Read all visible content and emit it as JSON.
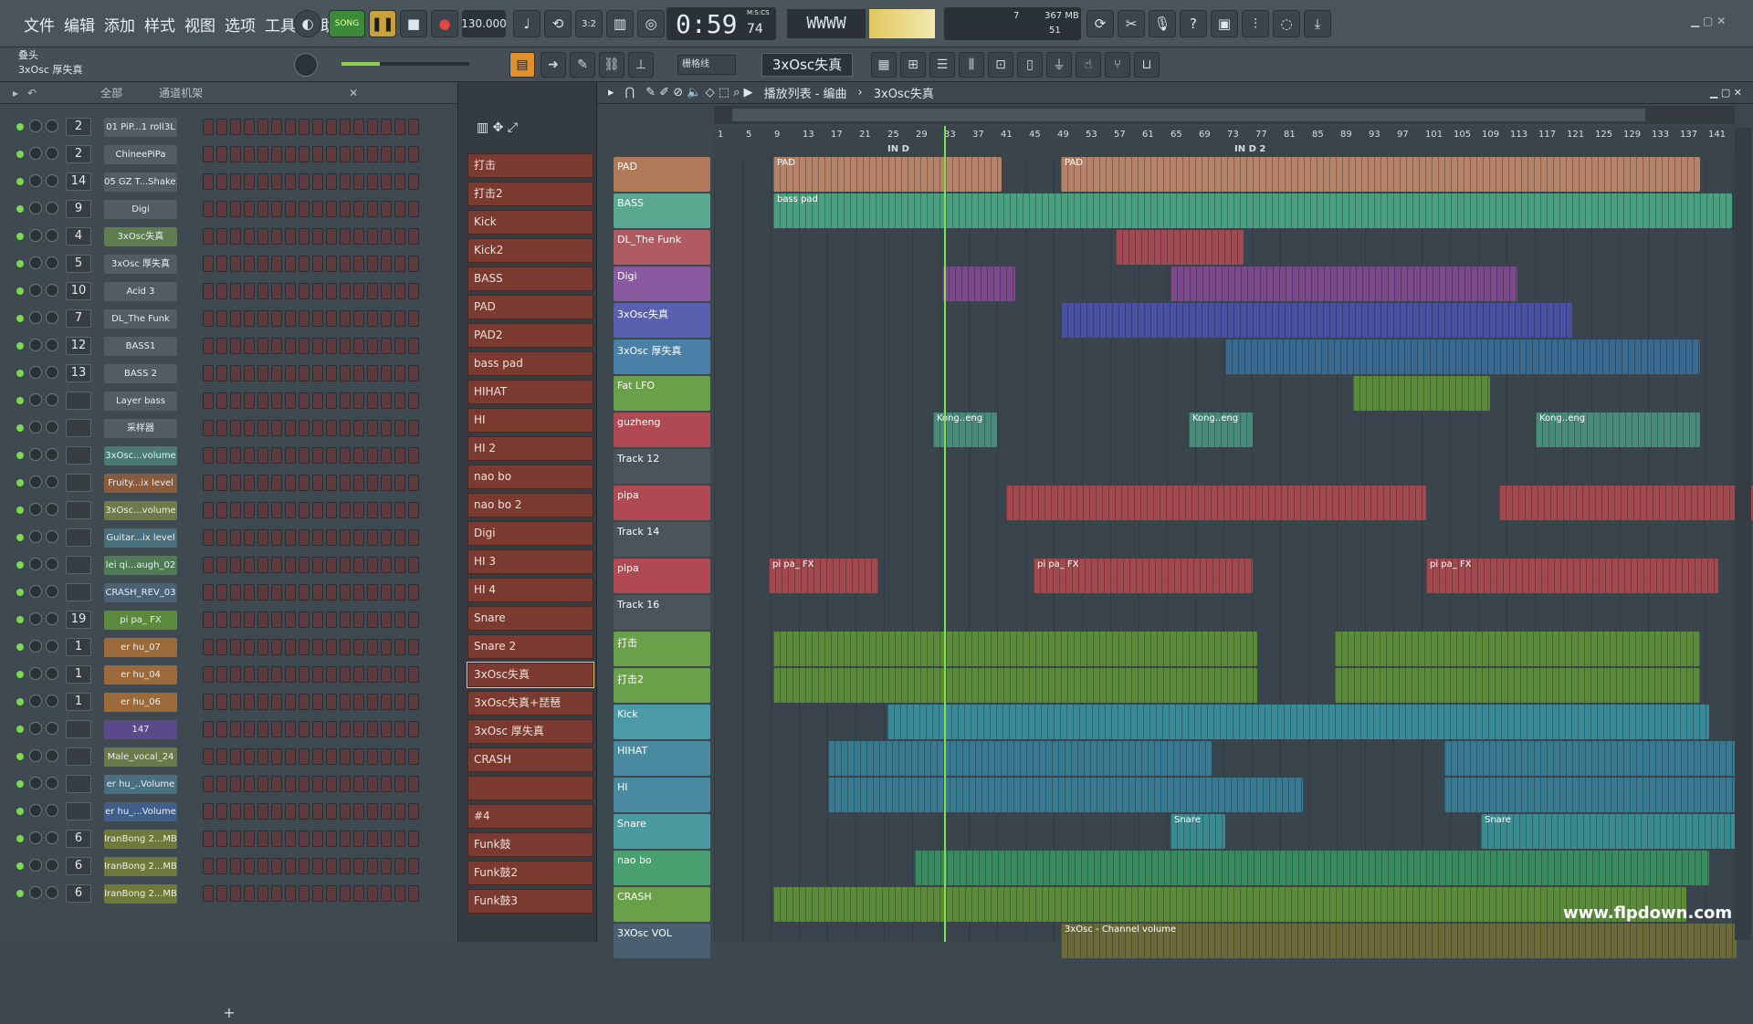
{
  "menu": [
    "文件",
    "编辑",
    "添加",
    "样式",
    "视图",
    "选项",
    "工具",
    "帮助"
  ],
  "transport": {
    "mode": "SONG",
    "tempo": "130.000",
    "time": "0:59",
    "time_sub": "74",
    "time_unit": "M:S:CS",
    "memory": "367 MB",
    "cpu": "7",
    "voices": "51",
    "pattern": "3xOsc失真",
    "snap": "栅格线"
  },
  "hint": {
    "line1": "叠头",
    "line2": "3xOsc 厚失真"
  },
  "rack": {
    "filter": "全部",
    "title": "通道机架",
    "add": "+",
    "channels": [
      {
        "num": "2",
        "name": "01 PiP...1 roll3L",
        "color": "#525c63"
      },
      {
        "num": "2",
        "name": "ChineePiPa",
        "color": "#525c63"
      },
      {
        "num": "14",
        "name": "05 GZ T...Shake3",
        "color": "#525c63"
      },
      {
        "num": "9",
        "name": "Digi",
        "color": "#525c63"
      },
      {
        "num": "4",
        "name": "3xOsc失真",
        "color": "#5f7d50"
      },
      {
        "num": "5",
        "name": "3xOsc 厚失真",
        "color": "#525c63"
      },
      {
        "num": "10",
        "name": "Acid 3",
        "color": "#525c63"
      },
      {
        "num": "7",
        "name": "DL_The Funk",
        "color": "#525c63"
      },
      {
        "num": "12",
        "name": "BASS1",
        "color": "#525c63"
      },
      {
        "num": "13",
        "name": "BASS 2",
        "color": "#525c63"
      },
      {
        "num": "",
        "name": "Layer bass",
        "color": "#525c63"
      },
      {
        "num": "",
        "name": "采样器",
        "color": "#525c63"
      },
      {
        "num": "",
        "name": "3xOsc...volume",
        "color": "#4b7a72"
      },
      {
        "num": "",
        "name": "Fruity...ix level",
        "color": "#8a5a3c"
      },
      {
        "num": "",
        "name": "3xOsc...volume",
        "color": "#6f7a4a"
      },
      {
        "num": "",
        "name": "Guitar...ix level",
        "color": "#4b6f7a"
      },
      {
        "num": "",
        "name": "lei qi...augh_02",
        "color": "#4f7a56"
      },
      {
        "num": "",
        "name": "CRASH_REV_03",
        "color": "#4b6274"
      },
      {
        "num": "19",
        "name": "pi pa_ FX",
        "color": "#5c8a3c"
      },
      {
        "num": "1",
        "name": "er hu_07",
        "color": "#9a6a3a"
      },
      {
        "num": "1",
        "name": "er hu_04",
        "color": "#9a6a3a"
      },
      {
        "num": "1",
        "name": "er hu_06",
        "color": "#9a6a3a"
      },
      {
        "num": "",
        "name": "147",
        "color": "#5b4a8a"
      },
      {
        "num": "",
        "name": "Male_vocal_24",
        "color": "#6a7a4a"
      },
      {
        "num": "",
        "name": "er hu_..Volume",
        "color": "#4a6f7e"
      },
      {
        "num": "",
        "name": "er hu_...Volume",
        "color": "#3f5f8a"
      },
      {
        "num": "6",
        "name": "IranBong 2...MB",
        "color": "#6f7a3a"
      },
      {
        "num": "6",
        "name": "IranBong 2...MB",
        "color": "#6f7a3a"
      },
      {
        "num": "6",
        "name": "IranBong 2...MB",
        "color": "#6f7a3a"
      }
    ]
  },
  "patterns": [
    "打击",
    "打击2",
    "Kick",
    "Kick2",
    "BASS",
    "PAD",
    "PAD2",
    "bass pad",
    "HIHAT",
    "HI",
    "HI 2",
    "nao bo",
    "nao bo 2",
    "Digi",
    "HI 3",
    "HI 4",
    "Snare",
    "Snare 2",
    "3xOsc失真",
    "3xOsc失真+琵琶",
    "3xOsc 厚失真",
    "CRASH",
    "",
    "#4",
    "Funk鼓",
    "Funk鼓2",
    "Funk鼓3"
  ],
  "playlist": {
    "title": "播放列表 - 编曲",
    "crumb": "3xOsc失真",
    "markers": [
      "IN D",
      "IN D 2"
    ],
    "ruler": [
      "1",
      "5",
      "9",
      "13",
      "17",
      "21",
      "25",
      "29",
      "33",
      "37",
      "41",
      "45",
      "49",
      "53",
      "57",
      "61",
      "65",
      "69",
      "73",
      "77",
      "81",
      "85",
      "89",
      "93",
      "97",
      "101",
      "105",
      "109",
      "113",
      "117",
      "121",
      "125",
      "129",
      "133",
      "137",
      "141"
    ],
    "tracks": [
      {
        "name": "PAD",
        "color": "#b07a5a"
      },
      {
        "name": "BASS",
        "color": "#5aa890"
      },
      {
        "name": "DL_The Funk",
        "color": "#b05a62"
      },
      {
        "name": "Digi",
        "color": "#8a5aa0"
      },
      {
        "name": "3xOsc失真",
        "color": "#5a60b0"
      },
      {
        "name": "3xOsc 厚失真",
        "color": "#4a80a8"
      },
      {
        "name": "Fat LFO",
        "color": "#6aa04a"
      },
      {
        "name": "guzheng",
        "color": "#b04a52"
      },
      {
        "name": "Track 12",
        "color": "#4a545b"
      },
      {
        "name": "pipa",
        "color": "#b04a52"
      },
      {
        "name": "Track 14",
        "color": "#4a545b"
      },
      {
        "name": "pipa",
        "color": "#b04a52"
      },
      {
        "name": "Track 16",
        "color": "#4a545b"
      },
      {
        "name": "打击",
        "color": "#6aa04a"
      },
      {
        "name": "打击2",
        "color": "#6aa04a"
      },
      {
        "name": "Kick",
        "color": "#4a9aa8"
      },
      {
        "name": "HIHAT",
        "color": "#4a8aa0"
      },
      {
        "name": "HI",
        "color": "#4a8aa0"
      },
      {
        "name": "Snare",
        "color": "#4a9aa0"
      },
      {
        "name": "nao bo",
        "color": "#4aa070"
      },
      {
        "name": "CRASH",
        "color": "#6aa04a"
      },
      {
        "name": "3XOsc VOL",
        "color": "#4a6070"
      }
    ],
    "clips": [
      {
        "t": 0,
        "label": "PAD",
        "color": "#b5826a"
      },
      {
        "t": 1,
        "label": "bass pad",
        "color": "#4aa080"
      },
      {
        "t": 2,
        "label": "",
        "color": "#a04a55"
      },
      {
        "t": 3,
        "label": "",
        "color": "#7a4a8a"
      },
      {
        "t": 4,
        "label": "",
        "color": "#4a50a0"
      },
      {
        "t": 5,
        "label": "",
        "color": "#3a6a90"
      },
      {
        "t": 6,
        "label": "",
        "color": "#5a8a3a"
      },
      {
        "t": 7,
        "label": "Kong..eng",
        "color": "#4a8a7a"
      },
      {
        "t": 9,
        "label": "",
        "color": "#a04a50"
      },
      {
        "t": 11,
        "label": "pi pa_ FX",
        "color": "#a04a50"
      },
      {
        "t": 13,
        "label": "",
        "color": "#5a8a3a"
      },
      {
        "t": 14,
        "label": "",
        "color": "#5a8a3a"
      },
      {
        "t": 15,
        "label": "",
        "color": "#3a8a98"
      },
      {
        "t": 16,
        "label": "",
        "color": "#3a7a90"
      },
      {
        "t": 17,
        "label": "",
        "color": "#3a7a90"
      },
      {
        "t": 18,
        "label": "Snare",
        "color": "#3a8a90"
      },
      {
        "t": 19,
        "label": "",
        "color": "#3a8a60"
      },
      {
        "t": 20,
        "label": "",
        "color": "#5a8a3a"
      },
      {
        "t": 21,
        "label": "3xOsc - Channel volume",
        "color": "#6a6a3a"
      }
    ]
  },
  "watermark": "www.flpdown.com"
}
